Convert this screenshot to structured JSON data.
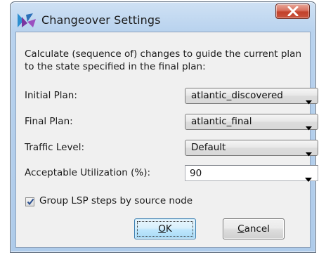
{
  "window": {
    "title": "Changeover Settings",
    "app_icon": "app-logo-icon",
    "close_icon": "close-icon"
  },
  "description": "Calculate (sequence of) changes to guide the current plan to the state specified in the final plan:",
  "fields": {
    "initial_plan": {
      "label": "Initial Plan:",
      "value": "atlantic_discovered"
    },
    "final_plan": {
      "label": "Final Plan:",
      "value": "atlantic_final"
    },
    "traffic_level": {
      "label": "Traffic Level:",
      "value": "Default"
    },
    "acceptable_utilization": {
      "label": "Acceptable Utilization (%):",
      "value": "90"
    }
  },
  "group_lsp": {
    "label": "Group LSP steps by source node",
    "checked": true
  },
  "buttons": {
    "ok": {
      "mnemonic": "O",
      "rest": "K"
    },
    "cancel": {
      "mnemonic": "C",
      "rest": "ancel"
    }
  },
  "colors": {
    "title_bar": "#b8d2ee",
    "close_button": "#c9553f",
    "client_bg": "#f0f0f0",
    "ok_button_border": "#3c7fb1"
  }
}
